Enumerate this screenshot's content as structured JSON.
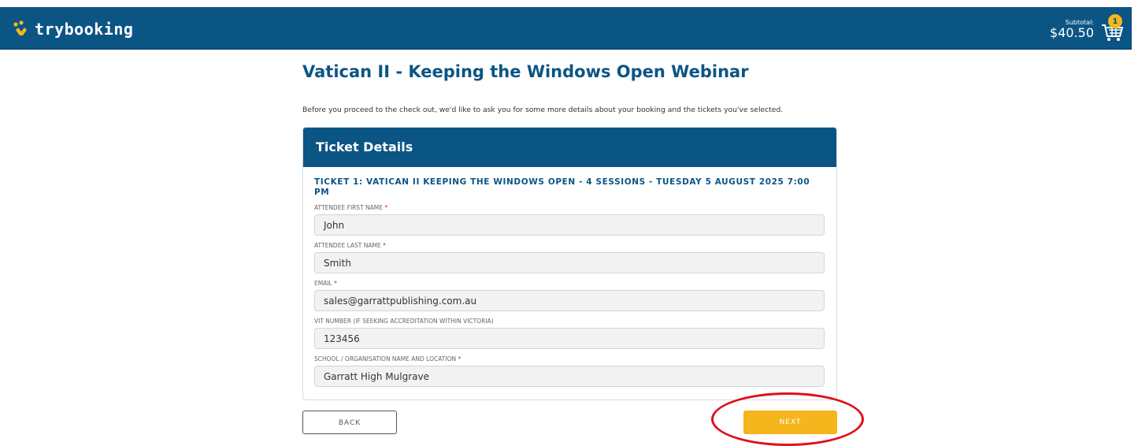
{
  "header": {
    "logo_text": "trybooking",
    "subtotal_label": "Subtotal:",
    "subtotal_value": "$40.50",
    "cart_count": "1",
    "colors": {
      "header_bg": "#0b5585",
      "accent": "#f5b51c"
    }
  },
  "page": {
    "title": "Vatican II - Keeping the Windows Open Webinar",
    "intro": "Before you proceed to the check out, we'd like to ask you for some more details about your booking and the tickets you've selected."
  },
  "card": {
    "heading": "Ticket Details",
    "ticket_title": "TICKET 1: VATICAN II KEEPING THE WINDOWS OPEN - 4 SESSIONS - TUESDAY 5 AUGUST 2025 7:00 PM",
    "fields": [
      {
        "label": "ATTENDEE FIRST NAME",
        "required": "*",
        "value": "John"
      },
      {
        "label": "ATTENDEE LAST NAME",
        "required": "*",
        "value": "Smith"
      },
      {
        "label": "EMAIL",
        "required": "*",
        "value": "sales@garrattpublishing.com.au"
      },
      {
        "label": "VIT NUMBER (IF SEEKING ACCREDITATION WITHIN VICTORIA)",
        "required": "",
        "value": "123456"
      },
      {
        "label": "SCHOOL / ORGANISATION NAME AND LOCATION",
        "required": "*",
        "value": "Garratt High Mulgrave"
      }
    ]
  },
  "actions": {
    "back_label": "BACK",
    "next_label": "NEXT"
  }
}
